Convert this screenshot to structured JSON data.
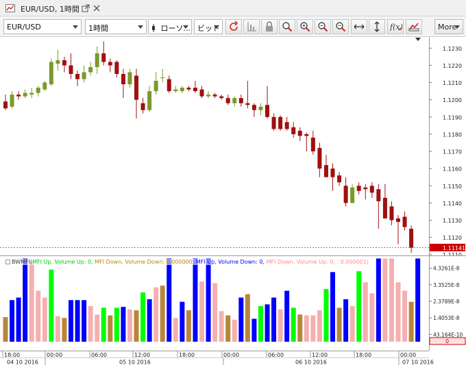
{
  "window": {
    "title": "EUR/USD, 1時間"
  },
  "toolbar": {
    "symbol": "EUR/USD",
    "timeframe": "1時間",
    "chart_type": "ローソ...",
    "price_type": "ビッド",
    "more_label": "More"
  },
  "indicator": {
    "name": "BWMFI",
    "items": [
      {
        "text": "MFI Up, Volume Up: 0,",
        "color": "#00dd00"
      },
      {
        "text": "MFI Down, Volume Down: 0.000000,",
        "color": "#b8860b"
      },
      {
        "text": "MFI Up, Volume Down: 0,",
        "color": "#0000ff"
      },
      {
        "text": "MFI Down, Volume Up: 0, : 0.000001)",
        "color": "#ff9999"
      }
    ]
  },
  "price_axis": {
    "labels": [
      "1.1230",
      "1.1220",
      "1.1210",
      "1.1200",
      "1.1190",
      "1.1180",
      "1.1170",
      "1.1160",
      "1.1150",
      "1.1140",
      "1.1130",
      "1.1120",
      "1.1110"
    ],
    "current_price": "1.11141"
  },
  "indicator_axis": {
    "labels": [
      "4.3261E-8",
      "3.3525E-8",
      "2.3789E-8",
      "1.4053E-8",
      "43.164E-10"
    ],
    "current_value": "0"
  },
  "time_axis": {
    "ticks": [
      "18:00",
      "00:00",
      "06:00",
      "12:00",
      "18:00",
      "00:00",
      "06:00",
      "12:00",
      "18:00",
      "00:00"
    ],
    "dates": [
      "04 10 2016",
      "05 10 2016",
      "06 10 2016",
      "07 10 2016"
    ]
  },
  "colors": {
    "bull": "#7a9a2a",
    "bear": "#a01010",
    "green_up": "#00ff00",
    "blue": "#0000ff",
    "brown": "#b8863b",
    "pink": "#f4b0b0"
  },
  "chart_data": {
    "type": "bar",
    "title": "",
    "candles": [
      {
        "o": 1.1199,
        "h": 1.1203,
        "l": 1.1194,
        "c": 1.1195
      },
      {
        "o": 1.1196,
        "h": 1.1205,
        "l": 1.1195,
        "c": 1.1203
      },
      {
        "o": 1.1203,
        "h": 1.1205,
        "l": 1.12,
        "c": 1.1202
      },
      {
        "o": 1.1202,
        "h": 1.1206,
        "l": 1.1201,
        "c": 1.1204
      },
      {
        "o": 1.1203,
        "h": 1.1207,
        "l": 1.1201,
        "c": 1.1204
      },
      {
        "o": 1.1204,
        "h": 1.1208,
        "l": 1.1202,
        "c": 1.1207
      },
      {
        "o": 1.1206,
        "h": 1.1211,
        "l": 1.1205,
        "c": 1.121
      },
      {
        "o": 1.1209,
        "h": 1.1224,
        "l": 1.1208,
        "c": 1.1222
      },
      {
        "o": 1.1221,
        "h": 1.1229,
        "l": 1.1217,
        "c": 1.1223
      },
      {
        "o": 1.1223,
        "h": 1.1225,
        "l": 1.1216,
        "c": 1.122
      },
      {
        "o": 1.122,
        "h": 1.1227,
        "l": 1.1212,
        "c": 1.1215
      },
      {
        "o": 1.1215,
        "h": 1.1217,
        "l": 1.1208,
        "c": 1.1212
      },
      {
        "o": 1.1212,
        "h": 1.122,
        "l": 1.121,
        "c": 1.1216
      },
      {
        "o": 1.1216,
        "h": 1.1222,
        "l": 1.1214,
        "c": 1.1219
      },
      {
        "o": 1.1219,
        "h": 1.1231,
        "l": 1.1215,
        "c": 1.1227
      },
      {
        "o": 1.1227,
        "h": 1.1234,
        "l": 1.122,
        "c": 1.1222
      },
      {
        "o": 1.1222,
        "h": 1.1224,
        "l": 1.1216,
        "c": 1.122
      },
      {
        "o": 1.1222,
        "h": 1.1223,
        "l": 1.1213,
        "c": 1.1215
      },
      {
        "o": 1.1215,
        "h": 1.1218,
        "l": 1.1201,
        "c": 1.1209
      },
      {
        "o": 1.1209,
        "h": 1.1218,
        "l": 1.1207,
        "c": 1.1216
      },
      {
        "o": 1.1214,
        "h": 1.1218,
        "l": 1.1189,
        "c": 1.12
      },
      {
        "o": 1.1198,
        "h": 1.1201,
        "l": 1.1192,
        "c": 1.1194
      },
      {
        "o": 1.1194,
        "h": 1.1208,
        "l": 1.1193,
        "c": 1.1205
      },
      {
        "o": 1.1205,
        "h": 1.1216,
        "l": 1.1203,
        "c": 1.1211
      },
      {
        "o": 1.1213,
        "h": 1.1218,
        "l": 1.121,
        "c": 1.1213
      },
      {
        "o": 1.1212,
        "h": 1.1214,
        "l": 1.1204,
        "c": 1.1205
      },
      {
        "o": 1.1205,
        "h": 1.1208,
        "l": 1.1204,
        "c": 1.1206
      },
      {
        "o": 1.1205,
        "h": 1.1208,
        "l": 1.1204,
        "c": 1.1207
      },
      {
        "o": 1.1207,
        "h": 1.1208,
        "l": 1.1205,
        "c": 1.1206
      },
      {
        "o": 1.1207,
        "h": 1.1211,
        "l": 1.1204,
        "c": 1.1205
      },
      {
        "o": 1.1206,
        "h": 1.1208,
        "l": 1.1201,
        "c": 1.1202
      },
      {
        "o": 1.1202,
        "h": 1.1205,
        "l": 1.1201,
        "c": 1.1203
      },
      {
        "o": 1.1203,
        "h": 1.1204,
        "l": 1.1201,
        "c": 1.1202
      },
      {
        "o": 1.1202,
        "h": 1.1203,
        "l": 1.12,
        "c": 1.1201
      },
      {
        "o": 1.1201,
        "h": 1.1203,
        "l": 1.1197,
        "c": 1.1198
      },
      {
        "o": 1.1198,
        "h": 1.1202,
        "l": 1.1196,
        "c": 1.1201
      },
      {
        "o": 1.1201,
        "h": 1.1203,
        "l": 1.1196,
        "c": 1.1198
      },
      {
        "o": 1.1198,
        "h": 1.1211,
        "l": 1.1195,
        "c": 1.1197
      },
      {
        "o": 1.1197,
        "h": 1.1198,
        "l": 1.119,
        "c": 1.1194
      },
      {
        "o": 1.1194,
        "h": 1.1198,
        "l": 1.1191,
        "c": 1.1196
      },
      {
        "o": 1.1197,
        "h": 1.1208,
        "l": 1.1189,
        "c": 1.119
      },
      {
        "o": 1.119,
        "h": 1.1192,
        "l": 1.1182,
        "c": 1.1183
      },
      {
        "o": 1.119,
        "h": 1.1191,
        "l": 1.1182,
        "c": 1.1183
      },
      {
        "o": 1.1187,
        "h": 1.119,
        "l": 1.1182,
        "c": 1.1183
      },
      {
        "o": 1.1184,
        "h": 1.1187,
        "l": 1.1178,
        "c": 1.118
      },
      {
        "o": 1.1182,
        "h": 1.1184,
        "l": 1.1176,
        "c": 1.1179
      },
      {
        "o": 1.118,
        "h": 1.1181,
        "l": 1.117,
        "c": 1.1179
      },
      {
        "o": 1.1178,
        "h": 1.1182,
        "l": 1.1168,
        "c": 1.117
      },
      {
        "o": 1.1172,
        "h": 1.1175,
        "l": 1.1155,
        "c": 1.116
      },
      {
        "o": 1.1162,
        "h": 1.1168,
        "l": 1.1155,
        "c": 1.1155
      },
      {
        "o": 1.116,
        "h": 1.1163,
        "l": 1.1147,
        "c": 1.1155
      },
      {
        "o": 1.1156,
        "h": 1.1158,
        "l": 1.115,
        "c": 1.1152
      },
      {
        "o": 1.115,
        "h": 1.1155,
        "l": 1.1138,
        "c": 1.114
      },
      {
        "o": 1.114,
        "h": 1.1151,
        "l": 1.114,
        "c": 1.1149
      },
      {
        "o": 1.115,
        "h": 1.1152,
        "l": 1.1145,
        "c": 1.1147
      },
      {
        "o": 1.1149,
        "h": 1.1151,
        "l": 1.1142,
        "c": 1.1148
      },
      {
        "o": 1.115,
        "h": 1.1152,
        "l": 1.1143,
        "c": 1.1146
      },
      {
        "o": 1.1148,
        "h": 1.1151,
        "l": 1.1125,
        "c": 1.1141
      },
      {
        "o": 1.1143,
        "h": 1.1151,
        "l": 1.1135,
        "c": 1.1131
      },
      {
        "o": 1.1138,
        "h": 1.1141,
        "l": 1.1127,
        "c": 1.113
      },
      {
        "o": 1.1131,
        "h": 1.1133,
        "l": 1.1116,
        "c": 1.1129
      },
      {
        "o": 1.1132,
        "h": 1.1135,
        "l": 1.1124,
        "c": 1.1126
      },
      {
        "o": 1.1125,
        "h": 1.1127,
        "l": 1.1111,
        "c": 1.1114
      }
    ],
    "indicator_bars": [
      {
        "v": 1.45,
        "c": "brown"
      },
      {
        "v": 2.45,
        "c": "blue"
      },
      {
        "v": 2.6,
        "c": "blue"
      },
      {
        "v": 4.9,
        "c": "blue"
      },
      {
        "v": 4.7,
        "c": "pink"
      },
      {
        "v": 3.0,
        "c": "pink"
      },
      {
        "v": 2.6,
        "c": "pink"
      },
      {
        "v": 4.25,
        "c": "green"
      },
      {
        "v": 1.5,
        "c": "pink"
      },
      {
        "v": 1.4,
        "c": "brown"
      },
      {
        "v": 2.45,
        "c": "blue"
      },
      {
        "v": 2.45,
        "c": "blue"
      },
      {
        "v": 2.45,
        "c": "blue"
      },
      {
        "v": 2.1,
        "c": "pink"
      },
      {
        "v": 1.6,
        "c": "pink"
      },
      {
        "v": 2.0,
        "c": "green"
      },
      {
        "v": 1.55,
        "c": "brown"
      },
      {
        "v": 2.0,
        "c": "green"
      },
      {
        "v": 2.05,
        "c": "blue"
      },
      {
        "v": 1.9,
        "c": "pink"
      },
      {
        "v": 1.85,
        "c": "brown"
      },
      {
        "v": 2.9,
        "c": "green"
      },
      {
        "v": 2.5,
        "c": "blue"
      },
      {
        "v": 3.2,
        "c": "pink"
      },
      {
        "v": 3.3,
        "c": "brown"
      },
      {
        "v": 4.9,
        "c": "blue"
      },
      {
        "v": 1.4,
        "c": "pink"
      },
      {
        "v": 2.35,
        "c": "blue"
      },
      {
        "v": 1.85,
        "c": "brown"
      },
      {
        "v": 4.9,
        "c": "blue"
      },
      {
        "v": 3.55,
        "c": "pink"
      },
      {
        "v": 4.9,
        "c": "blue"
      },
      {
        "v": 3.45,
        "c": "pink"
      },
      {
        "v": 1.8,
        "c": "pink"
      },
      {
        "v": 1.55,
        "c": "brown"
      },
      {
        "v": 1.3,
        "c": "pink"
      },
      {
        "v": 2.6,
        "c": "blue"
      },
      {
        "v": 2.8,
        "c": "brown"
      },
      {
        "v": 1.35,
        "c": "blue"
      },
      {
        "v": 2.1,
        "c": "green"
      },
      {
        "v": 2.2,
        "c": "blue"
      },
      {
        "v": 2.6,
        "c": "blue"
      },
      {
        "v": 1.9,
        "c": "pink"
      },
      {
        "v": 3.0,
        "c": "blue"
      },
      {
        "v": 2.0,
        "c": "green"
      },
      {
        "v": 1.6,
        "c": "brown"
      },
      {
        "v": 1.55,
        "c": "pink"
      },
      {
        "v": 1.55,
        "c": "pink"
      },
      {
        "v": 1.85,
        "c": "pink"
      },
      {
        "v": 3.1,
        "c": "green"
      },
      {
        "v": 4.1,
        "c": "blue"
      },
      {
        "v": 2.0,
        "c": "brown"
      },
      {
        "v": 2.5,
        "c": "blue"
      },
      {
        "v": 2.1,
        "c": "pink"
      },
      {
        "v": 4.15,
        "c": "green"
      },
      {
        "v": 3.5,
        "c": "pink"
      },
      {
        "v": 2.85,
        "c": "pink"
      },
      {
        "v": 4.9,
        "c": "blue"
      },
      {
        "v": 4.9,
        "c": "pink"
      },
      {
        "v": 4.9,
        "c": "pink"
      },
      {
        "v": 3.5,
        "c": "pink"
      },
      {
        "v": 3.0,
        "c": "pink"
      },
      {
        "v": 2.35,
        "c": "brown"
      },
      {
        "v": 4.9,
        "c": "blue"
      }
    ],
    "ylim": [
      1.11095,
      1.12365
    ],
    "indicator_ylim": [
      0,
      5.0
    ]
  }
}
